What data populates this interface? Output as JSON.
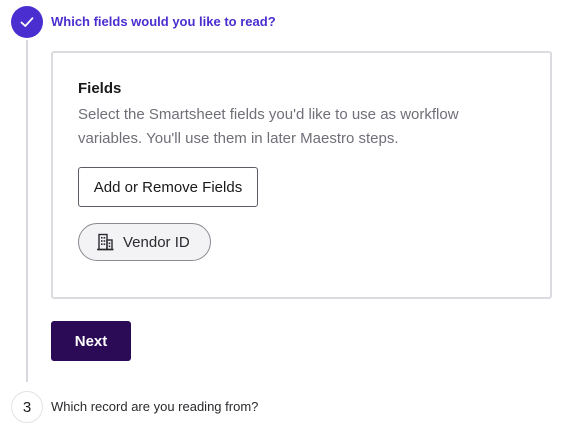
{
  "steps": {
    "current": {
      "title": "Which fields would you like to read?",
      "status_icon": "check-icon"
    },
    "next": {
      "number": "3",
      "title": "Which record are you reading from?"
    }
  },
  "fields_card": {
    "heading": "Fields",
    "description": "Select the Smartsheet fields you'd like to use as workflow variables. You'll use them in later Maestro steps.",
    "add_remove_label": "Add or Remove Fields",
    "selected_fields": [
      {
        "label": "Vendor ID",
        "icon": "building-icon"
      }
    ]
  },
  "actions": {
    "next_label": "Next"
  },
  "colors": {
    "accent": "#4b2ecf",
    "primary_button": "#2b0a56",
    "muted_text": "#6f6f78",
    "border": "#dcdce0"
  }
}
